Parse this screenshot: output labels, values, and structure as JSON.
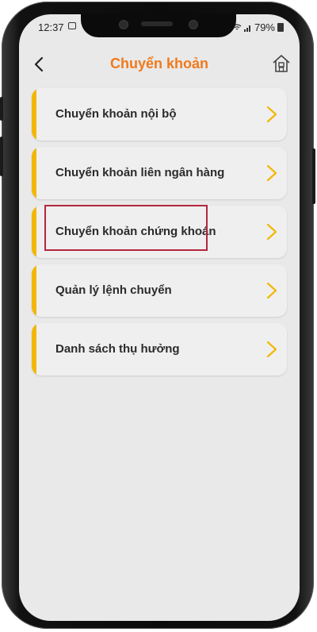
{
  "status": {
    "time": "12:37",
    "battery": "79%"
  },
  "header": {
    "title": "Chuyển khoản"
  },
  "menu": {
    "items": [
      {
        "label": "Chuyển khoản nội bộ"
      },
      {
        "label": "Chuyển khoản liên ngân hàng"
      },
      {
        "label": "Chuyển khoản chứng khoán"
      },
      {
        "label": "Quản lý lệnh chuyển"
      },
      {
        "label": "Danh sách thụ hưởng"
      }
    ]
  },
  "colors": {
    "accent": "#f2b705",
    "title": "#f07a1c",
    "highlight": "#b3273e",
    "chevron": "#f2b705"
  },
  "icons": [
    "back-arrow-icon",
    "home-icon",
    "chevron-right-icon",
    "image-icon",
    "wifi-icon",
    "signal-icon",
    "battery-icon"
  ]
}
